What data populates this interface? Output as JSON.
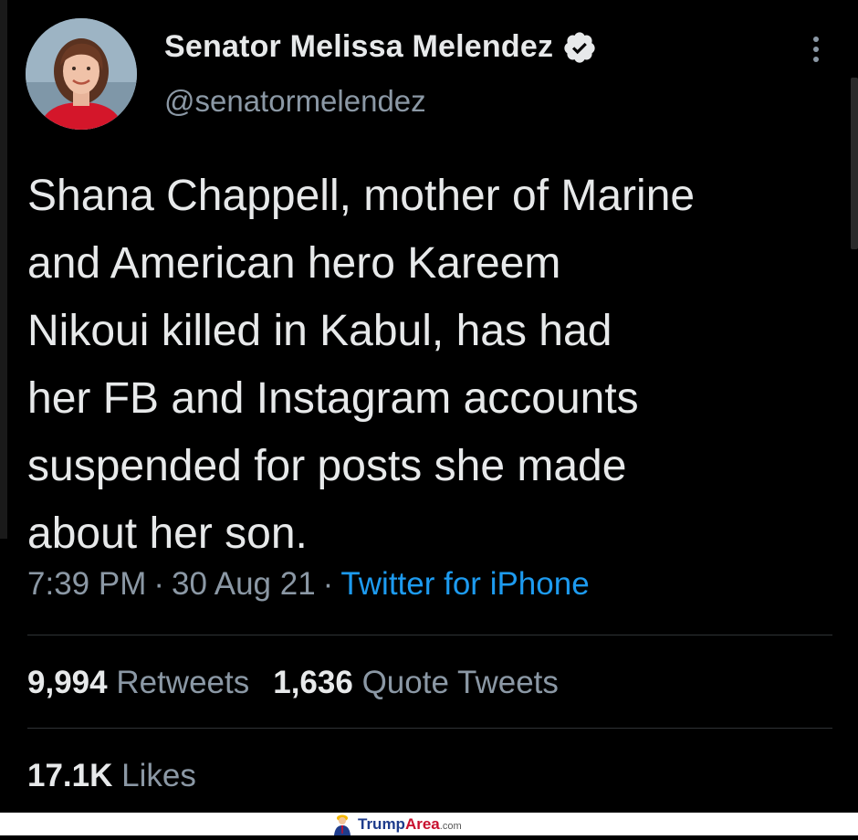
{
  "author": {
    "display_name": "Senator Melissa Melendez",
    "handle": "@senatormelendez",
    "verified": true
  },
  "tweet": {
    "text": "Shana Chappell, mother of Marine\nand American hero Kareem\nNikoui killed in Kabul, has had\nher FB and Instagram accounts\nsuspended for posts she made\nabout her son.",
    "time": "7:39 PM",
    "date": "30 Aug 21",
    "source": "Twitter for iPhone"
  },
  "stats": {
    "retweets_count": "9,994",
    "retweets_label": "Retweets",
    "quotes_count": "1,636",
    "quotes_label": "Quote Tweets",
    "likes_count": "17.1K",
    "likes_label": "Likes"
  },
  "watermark": {
    "part1": "Trump",
    "part2": "Area",
    "part3": ".com"
  },
  "colors": {
    "background": "#000000",
    "text_primary": "#e7e9ea",
    "text_secondary": "#8b98a5",
    "link": "#1d9bf0",
    "divider": "#2f3336"
  },
  "icons": {
    "verified": "verified-badge-icon",
    "more": "more-vertical-icon",
    "watermark_logo": "trump-figure-icon"
  }
}
